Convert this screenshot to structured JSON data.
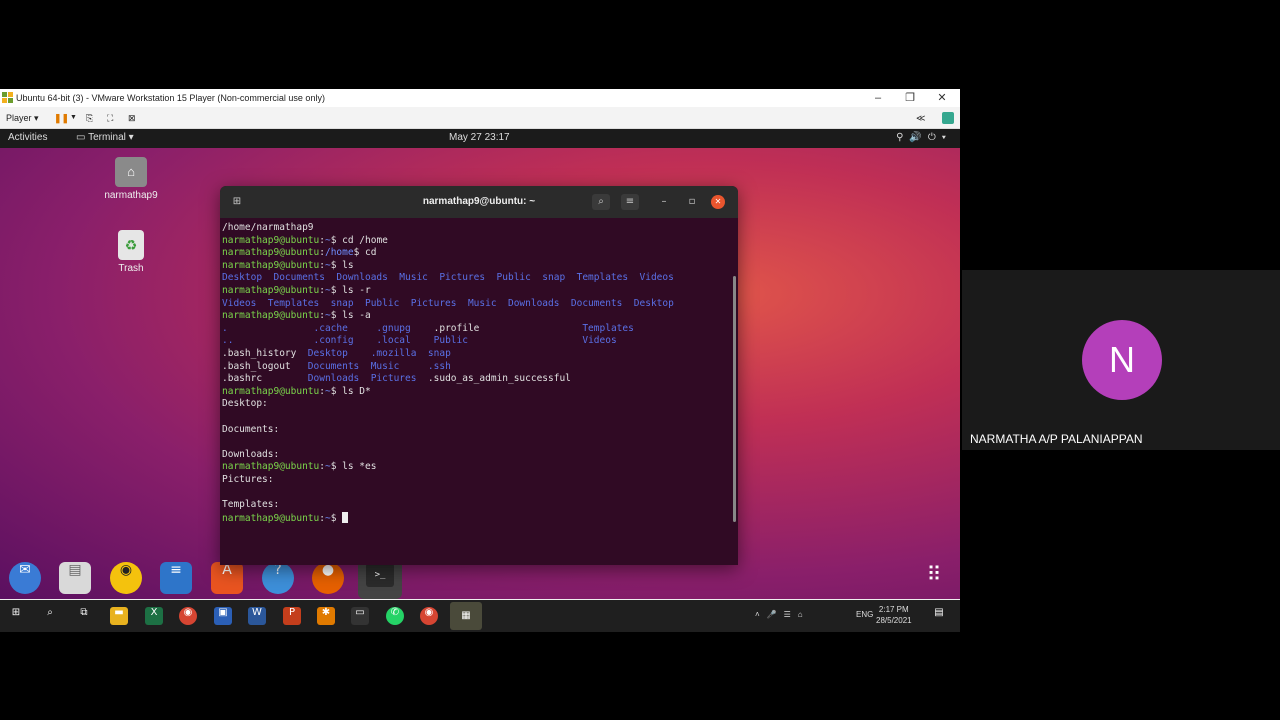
{
  "vmware": {
    "title": "Ubuntu 64-bit (3) - VMware Workstation 15 Player (Non-commercial use only)",
    "player_label": "Player",
    "controls": {
      "minimize": "–",
      "restore": "❐",
      "close": "✕"
    }
  },
  "ubuntu": {
    "activities": "Activities",
    "app_menu": "Terminal",
    "clock": "May 27  23:17",
    "desktop_icons": [
      {
        "label": "narmathap9",
        "icon": "home-folder-icon"
      },
      {
        "label": "Trash",
        "icon": "trash-icon"
      }
    ]
  },
  "terminal": {
    "title": "narmathap9@ubuntu: ~",
    "prompt_user": "narmathap9@ubuntu",
    "lines": [
      [
        {
          "t": "/home/narmathap9",
          "c": ""
        }
      ],
      [
        {
          "t": "narmathap9@ubuntu",
          "c": "pu"
        },
        {
          "t": ":",
          "c": ""
        },
        {
          "t": "~",
          "c": "pp"
        },
        {
          "t": "$ cd /home",
          "c": ""
        }
      ],
      [
        {
          "t": "narmathap9@ubuntu",
          "c": "pu"
        },
        {
          "t": ":",
          "c": ""
        },
        {
          "t": "/home",
          "c": "pp"
        },
        {
          "t": "$ cd",
          "c": ""
        }
      ],
      [
        {
          "t": "narmathap9@ubuntu",
          "c": "pu"
        },
        {
          "t": ":",
          "c": ""
        },
        {
          "t": "~",
          "c": "pp"
        },
        {
          "t": "$ ls",
          "c": ""
        }
      ],
      [
        {
          "t": "Desktop  Documents  Downloads  Music  Pictures  Public  snap  Templates  Videos",
          "c": "dir"
        }
      ],
      [
        {
          "t": "narmathap9@ubuntu",
          "c": "pu"
        },
        {
          "t": ":",
          "c": ""
        },
        {
          "t": "~",
          "c": "pp"
        },
        {
          "t": "$ ls -r",
          "c": ""
        }
      ],
      [
        {
          "t": "Videos  Templates  snap  Public  Pictures  Music  Downloads  Documents  Desktop",
          "c": "dir"
        }
      ],
      [
        {
          "t": "narmathap9@ubuntu",
          "c": "pu"
        },
        {
          "t": ":",
          "c": ""
        },
        {
          "t": "~",
          "c": "pp"
        },
        {
          "t": "$ ls -a",
          "c": ""
        }
      ],
      [
        {
          "t": ".               ",
          "c": "dir"
        },
        {
          "t": ".cache     .gnupg    ",
          "c": "dir"
        },
        {
          "t": ".profile",
          "c": ""
        },
        {
          "t": "                  Templates",
          "c": "dir"
        }
      ],
      [
        {
          "t": "..              ",
          "c": "dir"
        },
        {
          "t": ".config    .local    Public",
          "c": "dir"
        },
        {
          "t": "                    ",
          "c": ""
        },
        {
          "t": "Videos",
          "c": "dir"
        }
      ],
      [
        {
          "t": ".bash_history  ",
          "c": ""
        },
        {
          "t": "Desktop    .mozilla  snap",
          "c": "dir"
        }
      ],
      [
        {
          "t": ".bash_logout   ",
          "c": ""
        },
        {
          "t": "Documents  Music     .ssh",
          "c": "dir"
        }
      ],
      [
        {
          "t": ".bashrc        ",
          "c": ""
        },
        {
          "t": "Downloads  Pictures  ",
          "c": "dir"
        },
        {
          "t": ".sudo_as_admin_successful",
          "c": ""
        }
      ],
      [
        {
          "t": "narmathap9@ubuntu",
          "c": "pu"
        },
        {
          "t": ":",
          "c": ""
        },
        {
          "t": "~",
          "c": "pp"
        },
        {
          "t": "$ ls D*",
          "c": ""
        }
      ],
      [
        {
          "t": "Desktop:",
          "c": ""
        }
      ],
      [
        {
          "t": "",
          "c": ""
        }
      ],
      [
        {
          "t": "Documents:",
          "c": ""
        }
      ],
      [
        {
          "t": "",
          "c": ""
        }
      ],
      [
        {
          "t": "Downloads:",
          "c": ""
        }
      ],
      [
        {
          "t": "narmathap9@ubuntu",
          "c": "pu"
        },
        {
          "t": ":",
          "c": ""
        },
        {
          "t": "~",
          "c": "pp"
        },
        {
          "t": "$ ls *es",
          "c": ""
        }
      ],
      [
        {
          "t": "Pictures:",
          "c": ""
        }
      ],
      [
        {
          "t": "",
          "c": ""
        }
      ],
      [
        {
          "t": "Templates:",
          "c": ""
        }
      ],
      [
        {
          "t": "narmathap9@ubuntu",
          "c": "pu"
        },
        {
          "t": ":",
          "c": ""
        },
        {
          "t": "~",
          "c": "pp"
        },
        {
          "t": "$ ",
          "c": ""
        }
      ]
    ]
  },
  "taskbar": {
    "language": "ENG",
    "time": "2:17 PM",
    "date": "28/5/2021"
  },
  "participant": {
    "initial": "N",
    "name": "NARMATHA A/P PALANIAPPAN",
    "avatar_color": "#b43fba"
  }
}
